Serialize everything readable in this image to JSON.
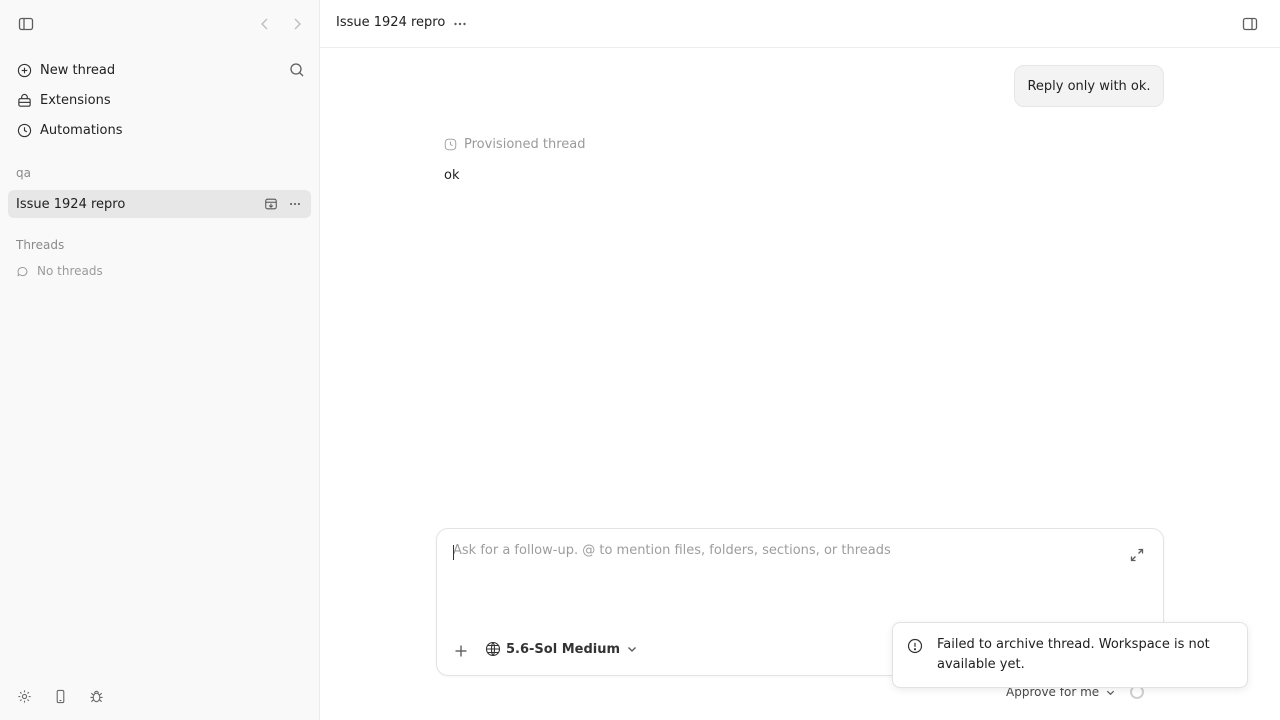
{
  "sidebar": {
    "nav": [
      {
        "label": "New thread",
        "icon": "plus-circle-icon"
      },
      {
        "label": "Extensions",
        "icon": "extensions-icon"
      },
      {
        "label": "Automations",
        "icon": "clock-icon"
      }
    ],
    "project_label": "qa",
    "active_thread": "Issue 1924 repro",
    "threads_label": "Threads",
    "no_threads": "No threads"
  },
  "header": {
    "title": "Issue 1924 repro"
  },
  "conversation": {
    "user_message": "Reply only with ok.",
    "status": "Provisioned thread",
    "assistant_message": "ok"
  },
  "composer": {
    "placeholder": "Ask for a follow-up. @ to mention files, folders, sections, or threads",
    "value": "",
    "model": "5.6-Sol Medium",
    "approval": "Approve for me"
  },
  "toast": {
    "message": "Failed to archive thread. Workspace is not available yet."
  }
}
